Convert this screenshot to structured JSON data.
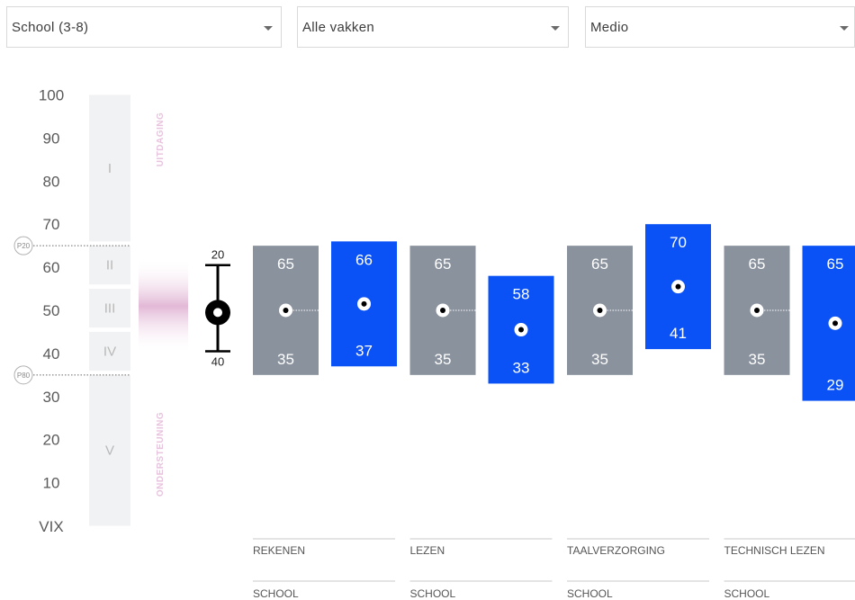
{
  "filters": {
    "group": "School (3-8)",
    "subject": "Alle vakken",
    "moment": "Medio"
  },
  "scale": {
    "ticks": [
      "100",
      "90",
      "80",
      "70",
      "60",
      "50",
      "40",
      "30",
      "20",
      "10",
      "VIX"
    ],
    "levels": [
      "I",
      "II",
      "III",
      "IV",
      "V"
    ],
    "top_label": "UITDAGING",
    "bottom_label": "ONDERSTEUNING",
    "p20_label": "P20",
    "p80_label": "P80"
  },
  "colors": {
    "school_bar": "#8a929e",
    "student_bar": "#0a52f5",
    "level_band": "#f1f2f3",
    "accent_pink": "#d9a3cb"
  },
  "legend_marker": {
    "top_label": "20",
    "bottom_label": "40"
  },
  "chart_data": {
    "type": "bar",
    "ylim": [
      0,
      100
    ],
    "y_ticks": [
      100,
      90,
      80,
      70,
      60,
      50,
      40,
      30,
      20,
      10
    ],
    "reference_lines": {
      "p20": 65,
      "p80": 35
    },
    "categories": [
      {
        "name": "REKENEN",
        "group_label": "SCHOOL",
        "reference_range": [
          35,
          65
        ],
        "range": [
          37,
          66
        ]
      },
      {
        "name": "LEZEN",
        "group_label": "SCHOOL",
        "reference_range": [
          35,
          65
        ],
        "range": [
          33,
          58
        ]
      },
      {
        "name": "TAALVERZORGING",
        "group_label": "SCHOOL",
        "reference_range": [
          35,
          65
        ],
        "range": [
          41,
          70
        ]
      },
      {
        "name": "TECHNISCH LEZEN",
        "group_label": "SCHOOL",
        "reference_range": [
          35,
          65
        ],
        "range": [
          29,
          65
        ]
      }
    ],
    "grid": false
  }
}
